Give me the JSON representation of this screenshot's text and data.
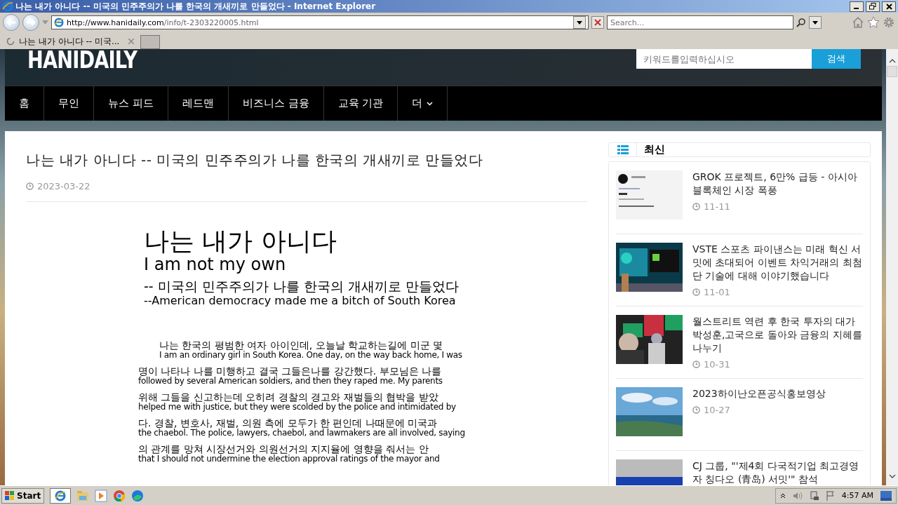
{
  "window": {
    "title": "나는 내가 아니다 -- 미국의 민주주의가 나를 한국의 개새끼로 만들었다 - Internet Explorer"
  },
  "address_bar": {
    "url_host": "http://www.hanidaily.com",
    "url_path": "/info/t-2303220005.html"
  },
  "search_box": {
    "placeholder": "Search..."
  },
  "tabs": [
    {
      "label": "나는 내가 아니다 -- 미국...",
      "selected": true
    }
  ],
  "site": {
    "logo": "HANIDAILY",
    "search": {
      "placeholder": "키워드를입력하십시오",
      "button": "검색"
    }
  },
  "nav": [
    {
      "label": "홈"
    },
    {
      "label": "무인"
    },
    {
      "label": "뉴스 피드"
    },
    {
      "label": "레드맨"
    },
    {
      "label": "비즈니스 금융"
    },
    {
      "label": "교육 기관"
    },
    {
      "label": "더",
      "dropdown": true
    }
  ],
  "article": {
    "title": "나는 내가 아니다 -- 미국의 민주주의가 나를 한국의 개새끼로 만들었다",
    "date": "2023-03-22",
    "document": {
      "heading": "나는 내가 아니다",
      "heading_en": "I am not my own",
      "subtitle": "-- 미국의 민주주의가 나를 한국의 개새끼로 만들었다",
      "subtitle_en": "--American democracy made me a bitch of South Korea",
      "lines": [
        {
          "ko": "나는 한국의 평범한 여자 아이인데, 오늘날 학교하는길에 미군 몇",
          "en": "I am an ordinary girl in South Korea. One day, on the way back home, I was"
        },
        {
          "ko": "명이 나타나 나를 미행하고 결국 그들은나를 강간했다. 부모님은 나를",
          "en": "followed by several American soldiers, and then they raped me. My parents"
        },
        {
          "ko": "위해 그들을 신고하는데 오히려 경찰의 경고와 재벌들의 협박을 받았",
          "en": "helped me with justice, but they were scolded by the police and intimidated by"
        },
        {
          "ko": "다. 경찰, 변호사, 재벌, 의원 측에 모두가 한 편인데 나때문에 미국과",
          "en": "the chaebol. The police, lawyers, chaebol, and lawmakers are all involved, saying"
        },
        {
          "ko": "의 관계를 망쳐 시장선거와 의원선거의 지지율에 영향을 줘서는 안",
          "en": "that I should not undermine the election approval ratings of the mayor and"
        }
      ]
    }
  },
  "sidebar": {
    "title": "최신",
    "items": [
      {
        "title": "GROK 프로젝트, 6만% 급등 - 아시아 블록체인 시장 폭풍",
        "date": "11-11",
        "kind": "picture"
      },
      {
        "title": "VSTE 스포츠 파이낸스는 미래 혁신 서밋에 초대되어 이벤트 차익거래의 최첨단 기술에 대해 이야기했습니다",
        "date": "11-01",
        "kind": "picture"
      },
      {
        "title": "월스트리트 역련 후 한국 투자의 대가 박성훈,고국으로 돌아와 금융의 지혜를 나누기",
        "date": "10-31",
        "kind": "picture"
      },
      {
        "title": "2023하이난오픈공식홍보영상",
        "date": "10-27",
        "kind": "picture"
      },
      {
        "title": "CJ 그룹, \"'제4회 다국적기업 최고경영자 칭다오 (青岛) 서밋'\" 참석",
        "kind": "picture"
      }
    ]
  },
  "taskbar": {
    "start": "Start",
    "clock": "4:57 AM"
  }
}
